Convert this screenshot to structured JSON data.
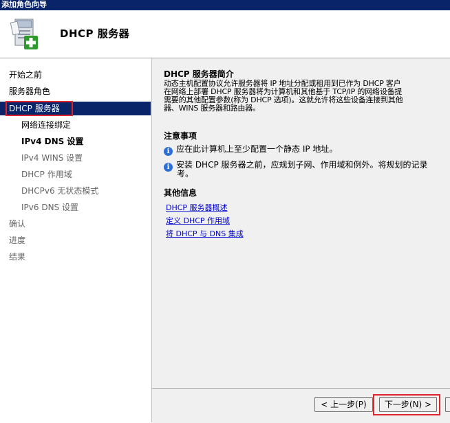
{
  "window": {
    "title": "添加角色向导"
  },
  "header": {
    "title": "DHCP 服务器",
    "icon": "server-add-icon"
  },
  "sidebar": {
    "items": [
      {
        "label": "开始之前"
      },
      {
        "label": "服务器角色"
      },
      {
        "label": "DHCP 服务器"
      },
      {
        "label": "网络连接绑定"
      },
      {
        "label": "IPv4 DNS 设置"
      },
      {
        "label": "IPv4 WINS 设置"
      },
      {
        "label": "DHCP 作用域"
      },
      {
        "label": "DHCPv6 无状态模式"
      },
      {
        "label": "IPv6 DNS 设置"
      },
      {
        "label": "确认"
      },
      {
        "label": "进度"
      },
      {
        "label": "结果"
      }
    ]
  },
  "main": {
    "intro_title": "DHCP 服务器简介",
    "intro_lines": [
      "动态主机配置协议允许服务器将 IP 地址分配或租用到已作为 DHCP 客户",
      "在网络上部署 DHCP 服务器将为计算机和其他基于 TCP/IP 的网络设备提",
      "需要的其他配置参数(称为 DHCP 选项)。这就允许将这些设备连接到其他",
      "器、WINS 服务器和路由器。"
    ],
    "notes_title": "注意事项",
    "notes": [
      "应在此计算机上至少配置一个静态 IP 地址。",
      "安装 DHCP 服务器之前，应规划子网、作用域和例外。将规划的记录",
      "考。"
    ],
    "more_title": "其他信息",
    "links": [
      "DHCP 服务器概述",
      "定义 DHCP 作用域",
      "将 DHCP 与 DNS 集成"
    ]
  },
  "footer": {
    "back_label": "< 上一步(P)",
    "next_label": "下一步(N) >"
  },
  "colors": {
    "accent": "#0a246a",
    "highlight": "#e0242b",
    "link": "#0000cc"
  }
}
